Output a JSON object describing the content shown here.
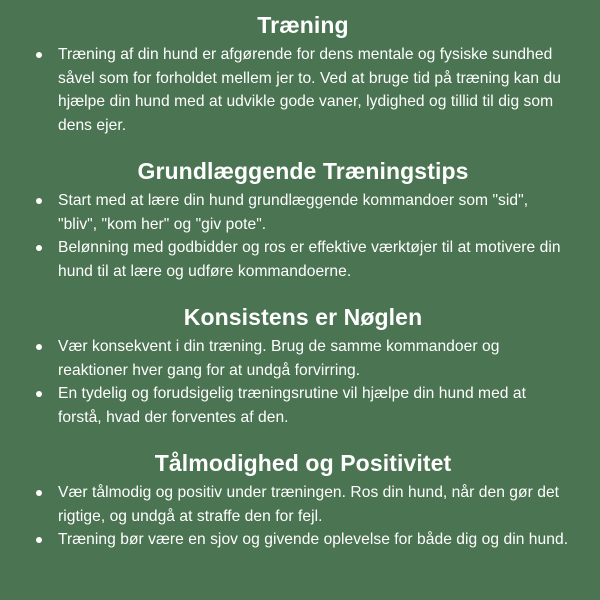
{
  "sections": [
    {
      "title": "Træning",
      "bullets": [
        "Træning af din hund er afgørende for dens mentale og fysiske sundhed såvel som for forholdet mellem jer to. Ved at bruge tid på træning kan du hjælpe din hund med at udvikle gode vaner, lydighed og tillid til dig som dens ejer."
      ]
    },
    {
      "title": "Grundlæggende Træningstips",
      "bullets": [
        "Start med at lære din hund grundlæggende kommandoer som \"sid\", \"bliv\", \"kom her\" og \"giv pote\".",
        "Belønning med godbidder og ros er effektive værktøjer til at motivere din hund til at lære og udføre kommandoerne."
      ]
    },
    {
      "title": "Konsistens er Nøglen",
      "bullets": [
        "Vær konsekvent i din træning. Brug de samme kommandoer og reaktioner hver gang for at undgå forvirring.",
        "En tydelig og forudsigelig træningsrutine vil hjælpe din hund med at forstå, hvad der forventes af den."
      ]
    },
    {
      "title": "Tålmodighed og Positivitet",
      "bullets": [
        "Vær tålmodig og positiv under træningen. Ros din hund, når den gør det rigtige, og undgå at straffe den for fejl.",
        "Træning bør være en sjov og givende oplevelse for både dig og din hund."
      ]
    }
  ],
  "colors": {
    "background": "#4b7452",
    "text": "#ffffff"
  }
}
